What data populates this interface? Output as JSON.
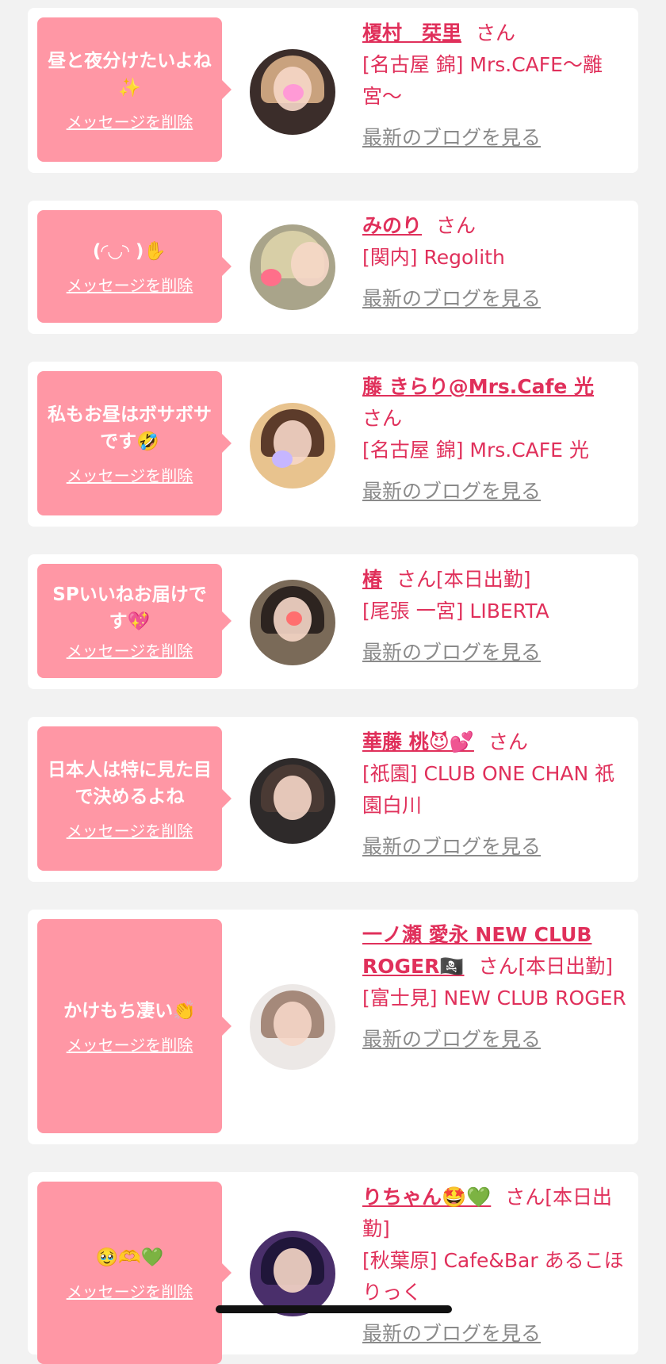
{
  "messages": [
    {
      "message": "昼と夜分けたいよね✨",
      "delete_label": "メッセージを削除",
      "name": "榎村　栞里",
      "honorific": "さん",
      "status": "",
      "shop": "[名古屋 錦] Mrs.CAFE〜離宮〜",
      "blog_link": "最新のブログを見る"
    },
    {
      "message": "(◜◡◝ )✋",
      "delete_label": "メッセージを削除",
      "name": "みのり",
      "honorific": "さん",
      "status": "",
      "shop": "[関内] Regolith",
      "blog_link": "最新のブログを見る"
    },
    {
      "message": "私もお昼はボサボサです🤣",
      "delete_label": "メッセージを削除",
      "name": "藤 きらり@Mrs.Cafe 光",
      "honorific": "さん",
      "status": "",
      "shop": "[名古屋 錦] Mrs.CAFE 光",
      "blog_link": "最新のブログを見る"
    },
    {
      "message": "SPいいねお届けです💖",
      "delete_label": "メッセージを削除",
      "name": "椿",
      "honorific": "さん",
      "status": "[本日出勤]",
      "shop": "[尾張 一宮] LIBERTA",
      "blog_link": "最新のブログを見る"
    },
    {
      "message": "日本人は特に見た目で決めるよね",
      "delete_label": "メッセージを削除",
      "name": "華藤 桃😈💕",
      "honorific": "さん",
      "status": "",
      "shop": "[祇園] CLUB ONE CHAN 祇園白川",
      "blog_link": "最新のブログを見る"
    },
    {
      "message": "かけもち凄い👏",
      "delete_label": "メッセージを削除",
      "name": "一ノ瀬 愛永 NEW CLUB ROGER🏴‍☠️",
      "honorific": "さん",
      "status": "[本日出勤]",
      "shop": "[富士見] NEW CLUB ROGER",
      "blog_link": "最新のブログを見る"
    },
    {
      "message": "🥹🫶💚",
      "delete_label": "メッセージを削除",
      "name": "りちゃん🤩💚",
      "honorific": "さん",
      "status": "[本日出勤]",
      "shop": "[秋葉原] Cafe&Bar あるこほりっく",
      "blog_link": "最新のブログを見る"
    }
  ]
}
